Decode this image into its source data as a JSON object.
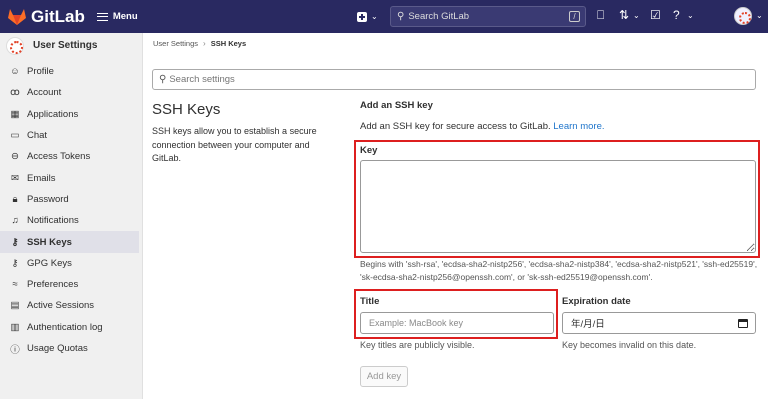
{
  "topbar": {
    "brand": "GitLab",
    "menu_label": "Menu",
    "search_placeholder": "Search GitLab",
    "search_shortcut": "/"
  },
  "sidebar": {
    "title": "User Settings",
    "items": [
      {
        "label": "Profile",
        "icon": "profile-icon"
      },
      {
        "label": "Account",
        "icon": "account-icon"
      },
      {
        "label": "Applications",
        "icon": "applications-icon"
      },
      {
        "label": "Chat",
        "icon": "chat-icon"
      },
      {
        "label": "Access Tokens",
        "icon": "token-icon"
      },
      {
        "label": "Emails",
        "icon": "mail-icon"
      },
      {
        "label": "Password",
        "icon": "lock-icon"
      },
      {
        "label": "Notifications",
        "icon": "bell-icon"
      },
      {
        "label": "SSH Keys",
        "icon": "key-icon"
      },
      {
        "label": "GPG Keys",
        "icon": "key-icon"
      },
      {
        "label": "Preferences",
        "icon": "preferences-icon"
      },
      {
        "label": "Active Sessions",
        "icon": "sessions-icon"
      },
      {
        "label": "Authentication log",
        "icon": "log-icon"
      },
      {
        "label": "Usage Quotas",
        "icon": "quota-icon"
      }
    ],
    "active_index": 8
  },
  "breadcrumb": {
    "parent": "User Settings",
    "current": "SSH Keys"
  },
  "settings_search": {
    "placeholder": "Search settings"
  },
  "page": {
    "title": "SSH Keys",
    "description": "SSH keys allow you to establish a secure connection between your computer and GitLab."
  },
  "form": {
    "heading": "Add an SSH key",
    "intro": "Add an SSH key for secure access to GitLab.",
    "learn_more": "Learn more.",
    "key_label": "Key",
    "key_value": "",
    "key_help": "Begins with 'ssh-rsa', 'ecdsa-sha2-nistp256', 'ecdsa-sha2-nistp384', 'ecdsa-sha2-nistp521', 'ssh-ed25519', 'sk-ecdsa-sha2-nistp256@openssh.com', or 'sk-ssh-ed25519@openssh.com'.",
    "title_label": "Title",
    "title_placeholder": "Example: MacBook key",
    "title_help": "Key titles are publicly visible.",
    "expiration_label": "Expiration date",
    "expiration_value": "年/月/日",
    "expiration_help": "Key becomes invalid on this date.",
    "submit_label": "Add key"
  },
  "colors": {
    "topbar_bg": "#292961",
    "sidebar_bg": "#f0f0f0",
    "highlight_red": "#dd1f1f",
    "link_blue": "#1f75cb"
  }
}
